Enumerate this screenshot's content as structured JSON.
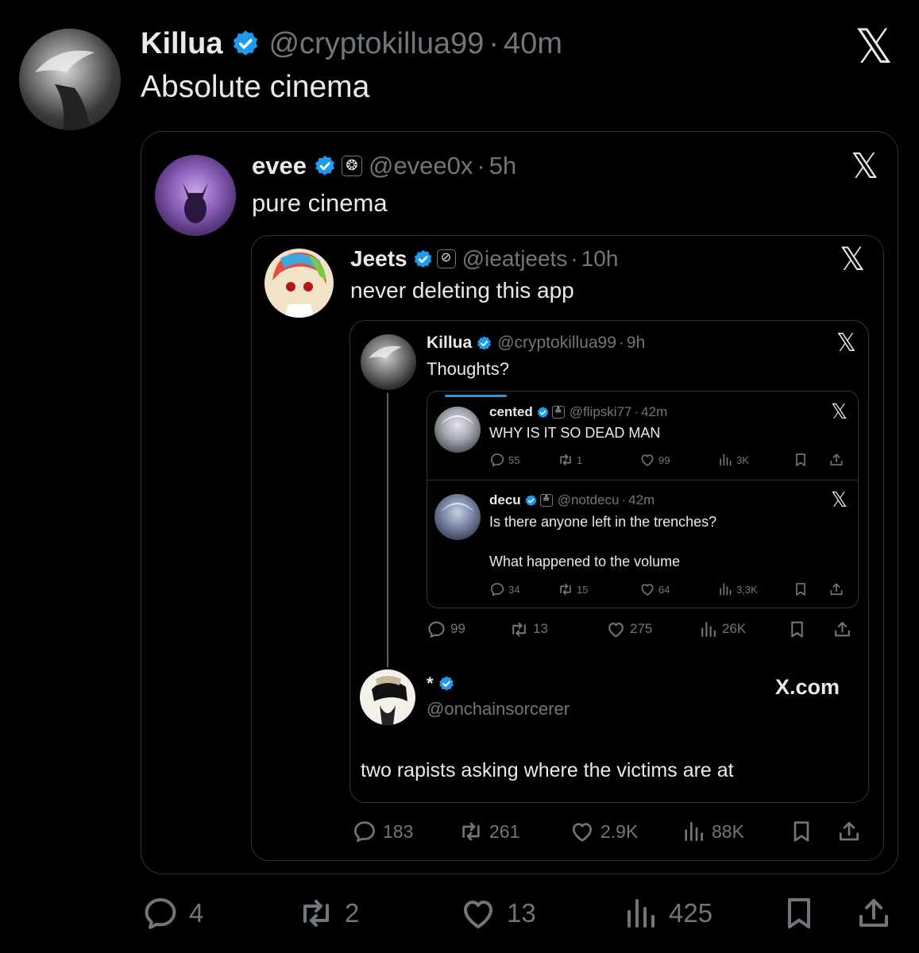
{
  "outer": {
    "name": "Killua",
    "handle": "@cryptokillua99",
    "time": "40m",
    "text": "Absolute cinema",
    "stats": {
      "replies": "4",
      "reposts": "2",
      "likes": "13",
      "views": "425"
    }
  },
  "quote1": {
    "name": "evee",
    "handle": "@evee0x",
    "time": "5h",
    "text": "pure cinema",
    "stats": {
      "replies": "183",
      "reposts": "261",
      "likes": "2.9K",
      "views": "88K"
    }
  },
  "quote2": {
    "name": "Jeets",
    "handle": "@ieatjeets",
    "time": "10h",
    "text": "never deleting this app"
  },
  "quote3": {
    "name": "Killua",
    "handle": "@cryptokillua99",
    "time": "9h",
    "text": "Thoughts?",
    "stats": {
      "replies": "99",
      "reposts": "13",
      "likes": "275",
      "views": "26K"
    }
  },
  "replies": [
    {
      "name": "cented",
      "handle": "@flipski77",
      "time": "42m",
      "text": "WHY IS IT SO DEAD MAN",
      "stats": {
        "replies": "55",
        "reposts": "1",
        "likes": "99",
        "views": "3K"
      }
    },
    {
      "name": "decu",
      "handle": "@notdecu",
      "time": "42m",
      "text": "Is there anyone left in the trenches?",
      "text2": "What happened to the volume",
      "stats": {
        "replies": "34",
        "reposts": "15",
        "likes": "64",
        "views": "3,3K"
      }
    }
  ],
  "reply_card": {
    "name": "*",
    "handle": "@onchainsorcerer",
    "site": "X.com",
    "text": "two rapists asking where the victims are at"
  },
  "colors": {
    "background": "#000000",
    "verified": "#1d9bf0",
    "muted": "#71767b",
    "border": "#2f3336"
  }
}
